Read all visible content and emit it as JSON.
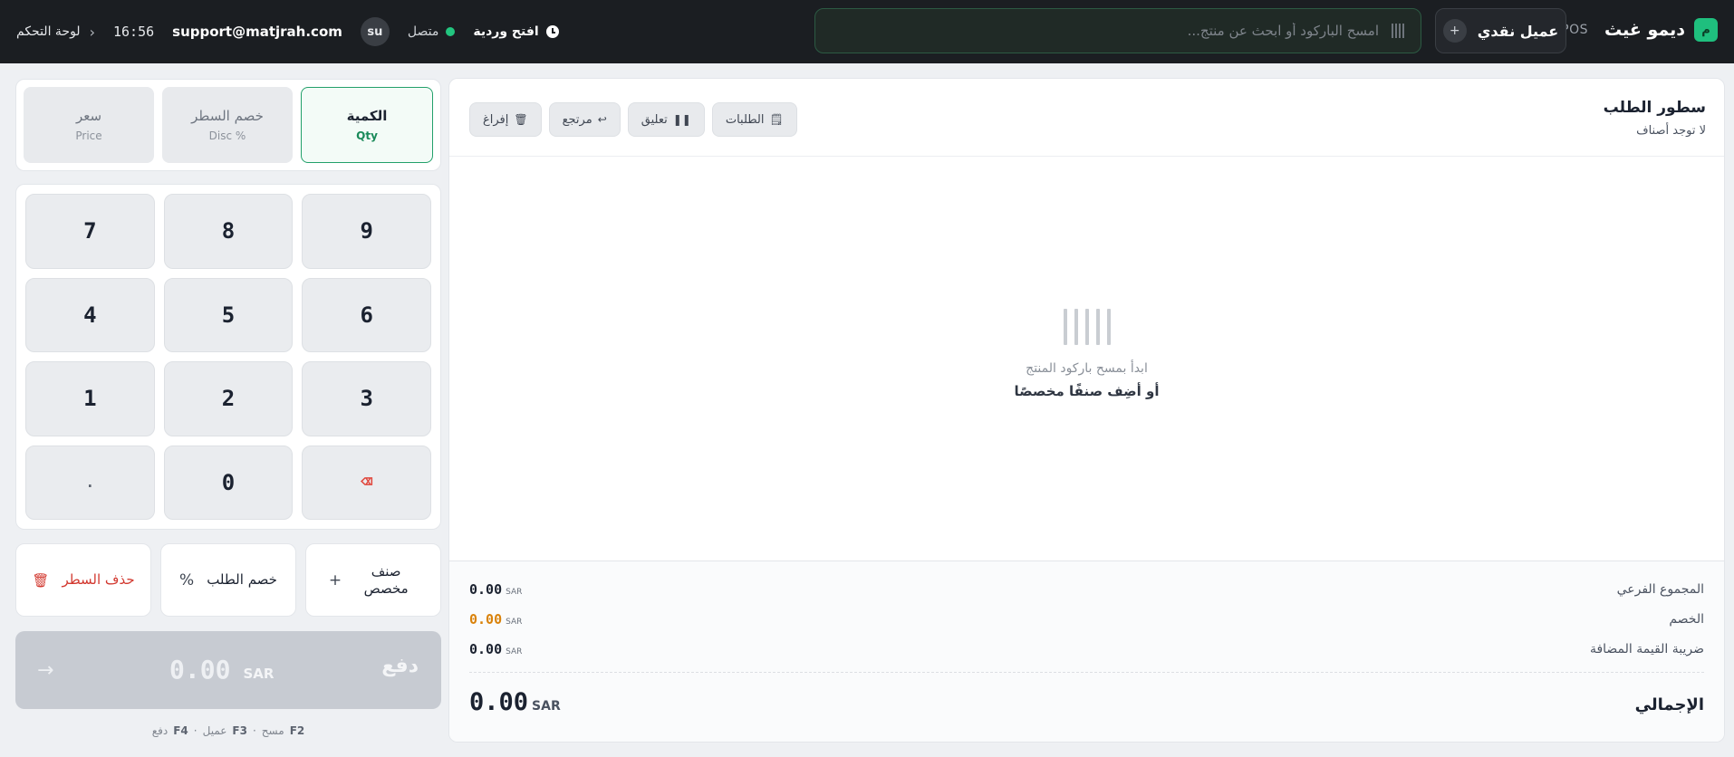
{
  "topbar": {
    "brand_logo": "م",
    "brand_name": "ديمو غيث",
    "brand_pos": "POS",
    "customer_label": "عميل نقدي",
    "customer_plus": "+",
    "search_placeholder": "امسح الباركود أو ابحث عن منتج...",
    "shift_label": "افتح وردية",
    "status_label": "متصل",
    "status_color": "#22c57f",
    "avatar": "su",
    "email": "support@matjrah.com",
    "time": "16:56",
    "dashboard_label": "لوحة التحكم"
  },
  "order": {
    "title": "سطور الطلب",
    "subtitle": "لا توجد أصناف",
    "actions": {
      "orders": "الطلبات",
      "hold": "تعليق",
      "return": "مرتجع",
      "clear": "إفراغ"
    },
    "empty_line1": "ابدأ بمسح باركود المنتج",
    "empty_line2": "أو أضِف صنفًا مخصصًا",
    "totals": {
      "subtotal_label": "المجموع الفرعي",
      "subtotal_value": "0.00",
      "discount_label": "الخصم",
      "discount_value": "0.00",
      "vat_label": "ضريبة القيمة المضافة",
      "vat_value": "0.00",
      "currency": "SAR",
      "grand_label": "الإجمالي",
      "grand_value": "0.00",
      "discount_color": "#d9820a"
    }
  },
  "modes": [
    {
      "ar": "الكمية",
      "en": "Qty",
      "active": true
    },
    {
      "ar": "خصم السطر",
      "en": "% Disc",
      "active": false
    },
    {
      "ar": "سعر",
      "en": "Price",
      "active": false
    }
  ],
  "keypad": [
    "7",
    "8",
    "9",
    "4",
    "5",
    "6",
    "1",
    "2",
    "3",
    ".",
    "0",
    "⌫"
  ],
  "line_actions": {
    "custom_item": "صنف مخصص",
    "order_discount": "خصم الطلب",
    "delete_line": "حذف السطر"
  },
  "pay": {
    "label": "دفع",
    "amount": "0.00",
    "currency": "SAR"
  },
  "shortcuts": [
    {
      "key": "F2",
      "label": "مسح"
    },
    {
      "key": "F3",
      "label": "عميل"
    },
    {
      "key": "F4",
      "label": "دفع"
    }
  ]
}
